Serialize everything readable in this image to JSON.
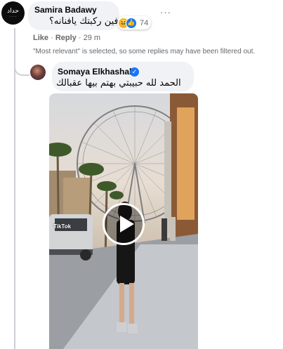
{
  "comment": {
    "avatar_text": "حداد",
    "avatar_subtext": "·· ·· ··",
    "author": "Samira Badawy",
    "text": "الا فين ركبتك يافنانه؟",
    "reactions": {
      "icons": [
        "haha-emoji",
        "like-emoji"
      ],
      "haha_glyph": "😆",
      "like_glyph": "👍",
      "count": "74"
    },
    "more_label": "···",
    "actions": {
      "like": "Like",
      "separator": "·",
      "reply": "Reply",
      "time": "29 m"
    },
    "filter_note": "\"Most relevant\" is selected, so some replies may have been filtered out."
  },
  "reply": {
    "author": "Somaya Elkhashab",
    "verified_glyph": "✓",
    "text": "الحمد لله حبيبتي بهتم بيها عقبالك",
    "video": {
      "watermark": "TikTok"
    }
  },
  "colors": {
    "bubble": "#f0f2f5",
    "secondary_text": "#65676b",
    "verified": "#1877f2",
    "haha": "#f7b125",
    "like": "#1877f2"
  }
}
